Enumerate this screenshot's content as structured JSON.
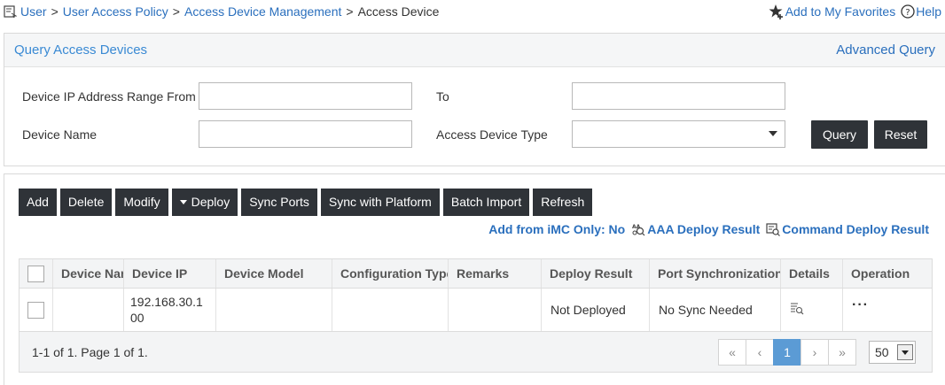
{
  "breadcrumb": {
    "items": [
      "User",
      "User Access Policy",
      "Access Device Management"
    ],
    "current": "Access Device",
    "separator": ">"
  },
  "top_links": {
    "favorites": "Add to My Favorites",
    "help": "Help"
  },
  "query_panel": {
    "title": "Query Access Devices",
    "advanced_link": "Advanced Query",
    "ip_from_label": "Device IP Address Range From",
    "ip_from_value": "",
    "to_label": "To",
    "to_value": "",
    "device_name_label": "Device Name",
    "device_name_value": "",
    "device_type_label": "Access Device Type",
    "device_type_value": "",
    "query_button": "Query",
    "reset_button": "Reset"
  },
  "toolbar": {
    "add": "Add",
    "delete": "Delete",
    "modify": "Modify",
    "deploy": "Deploy",
    "sync_ports": "Sync Ports",
    "sync_platform": "Sync with Platform",
    "batch_import": "Batch Import",
    "refresh": "Refresh"
  },
  "result_links": {
    "imc_only": "Add from iMC Only: No",
    "aaa_result": "AAA Deploy Result",
    "command_result": "Command Deploy Result"
  },
  "table": {
    "columns": [
      "Device Name",
      "Device IP",
      "Device Model",
      "Configuration Type",
      "Remarks",
      "Deploy Result",
      "Port Synchronization",
      "Details",
      "Operation"
    ],
    "rows": [
      {
        "device_name": "",
        "device_ip_line1": "192.168.30.1",
        "device_ip_line2": "00",
        "device_model": "",
        "configuration_type": "",
        "remarks": "",
        "deploy_result": "Not Deployed",
        "port_sync": "No Sync Needed",
        "operation": "···"
      }
    ]
  },
  "footer": {
    "info": "1-1 of 1. Page 1 of 1.",
    "current_page": "1",
    "page_size": "50",
    "nav_first": "«",
    "nav_prev": "‹",
    "nav_next": "›",
    "nav_last": "»"
  },
  "colors": {
    "link": "#2a6fbd",
    "button": "#2f3338",
    "active_page": "#5b9bd5"
  }
}
